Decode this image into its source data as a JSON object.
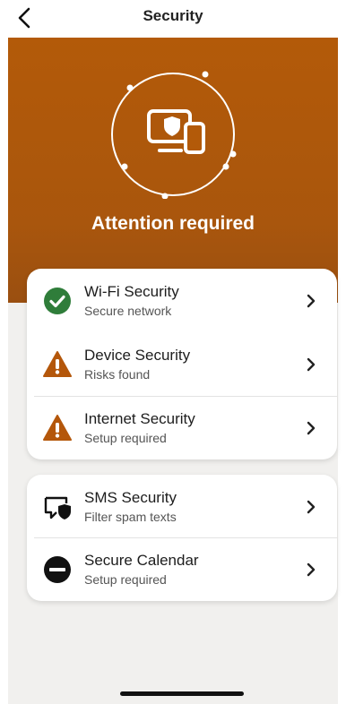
{
  "header": {
    "title": "Security"
  },
  "hero": {
    "status_title": "Attention required"
  },
  "security_items": [
    {
      "label": "Wi-Fi Security",
      "sub": "Secure network",
      "icon": "check-circle-icon",
      "status_color": "#2f7d3a"
    },
    {
      "label": "Device Security",
      "sub": "Risks found",
      "icon": "warning-icon",
      "status_color": "#b4570b"
    },
    {
      "label": "Internet Security",
      "sub": "Setup required",
      "icon": "warning-icon",
      "status_color": "#b4570b"
    }
  ],
  "other_items": [
    {
      "label": "SMS Security",
      "sub": "Filter spam texts",
      "icon": "sms-shield-icon"
    },
    {
      "label": "Secure Calendar",
      "sub": "Setup required",
      "icon": "minus-circle-icon"
    }
  ],
  "colors": {
    "hero_orange": "#b35a09",
    "warning": "#b4570b",
    "ok_green": "#2f7d3a"
  }
}
